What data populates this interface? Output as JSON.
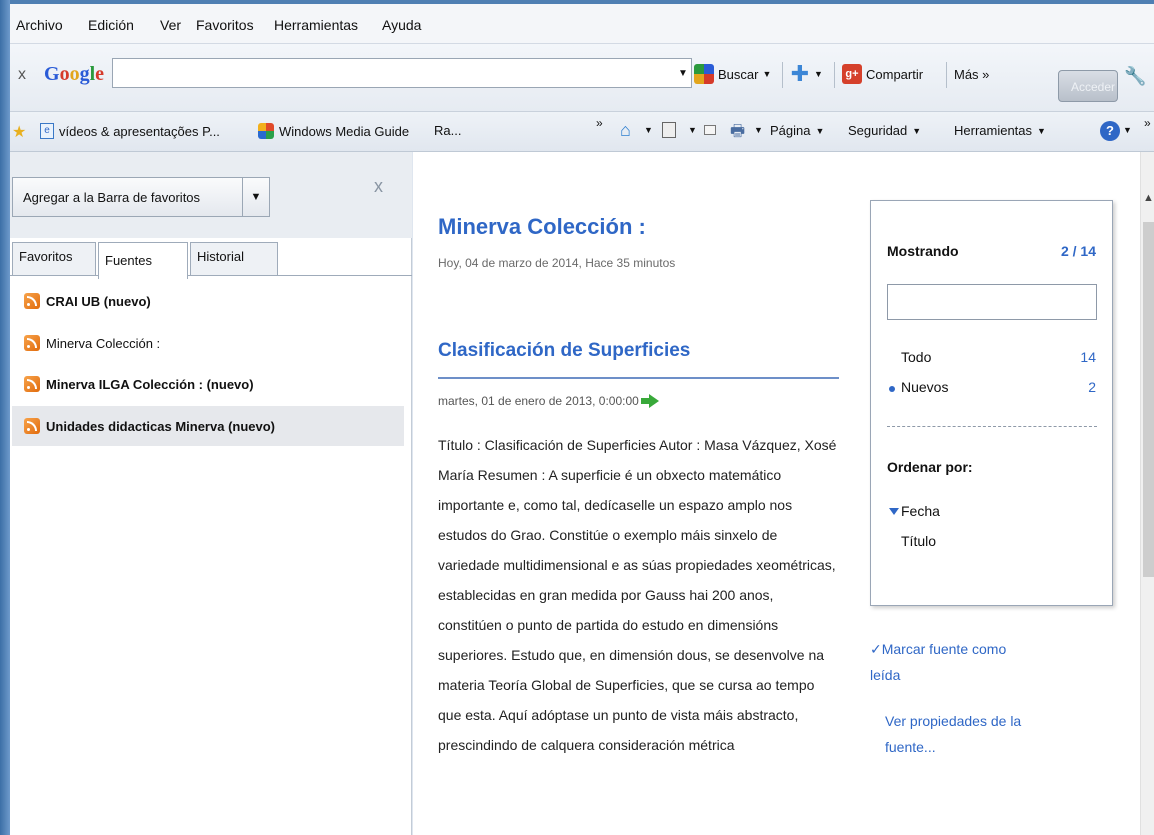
{
  "menu": [
    "Archivo",
    "Edición",
    "Ver",
    "Favoritos",
    "Herramientas",
    "Ayuda"
  ],
  "google_toolbar": {
    "close": "x",
    "logo": [
      "G",
      "o",
      "o",
      "g",
      "l",
      "e"
    ],
    "search_value": "",
    "buscar": "Buscar",
    "compartir": "Compartir",
    "mas": "Más »",
    "acceder": "Acceder"
  },
  "favorites_bar": {
    "items": [
      "vídeos & apresentações P...",
      "Windows Media Guide",
      "Ra..."
    ],
    "overflow": "»",
    "pagina": "Página",
    "seguridad": "Seguridad",
    "herramientas": "Herramientas"
  },
  "pane": {
    "add_button": "Agregar a la Barra de favoritos",
    "close": "x",
    "tabs": [
      "Favoritos",
      "Fuentes",
      "Historial"
    ],
    "active_tab": "Fuentes",
    "feeds": [
      {
        "name": "CRAI UB (nuevo)",
        "bold": true
      },
      {
        "name": "Minerva Colección :",
        "bold": false
      },
      {
        "name": "Minerva ILGA Colección : (nuevo)",
        "bold": true
      },
      {
        "name": "Unidades didacticas Minerva (nuevo)",
        "bold": true,
        "selected": true
      }
    ]
  },
  "content": {
    "feed_title": "Minerva Colección :",
    "feed_date": "Hoy, 04 de marzo de 2014, Hace 35 minutos",
    "item_title": "Clasificación de Superficies",
    "item_date": "martes, 01 de enero de 2013, 0:00:00",
    "item_body": "Título : Clasificación de Superficies Autor : Masa Vázquez, Xosé María Resumen : A superficie é un obxecto matemático importante e, como tal, dedícaselle un espazo amplo nos estudos do Grao. Constitúe o exemplo máis sinxelo de variedade multidimensional e as súas propiedades xeométricas, establecidas en gran medida por Gauss hai 200 anos, constitúen o punto de partida do estudo en dimensións superiores. Estudo que, en dimensión dous, se desenvolve na materia Teoría Global de Superficies, que se cursa ao tempo que esta. Aquí adóptase un punto de vista máis abstracto, prescindindo de calquera consideración métrica"
  },
  "filter": {
    "showing_label": "Mostrando",
    "showing_count": "2 / 14",
    "search_value": "",
    "all_label": "Todo",
    "all_count": "14",
    "new_label": "Nuevos",
    "new_count": "2",
    "order_label": "Ordenar por:",
    "order_date": "Fecha",
    "order_title": "Título"
  },
  "side_links": {
    "mark_read_1": "Marcar fuente como",
    "mark_read_2": "leída",
    "properties_1": "Ver propiedades de la",
    "properties_2": "fuente..."
  },
  "colors": {
    "link": "#2f67c6",
    "accent_green": "#39a93a",
    "rss_orange": "#e16b0c"
  }
}
